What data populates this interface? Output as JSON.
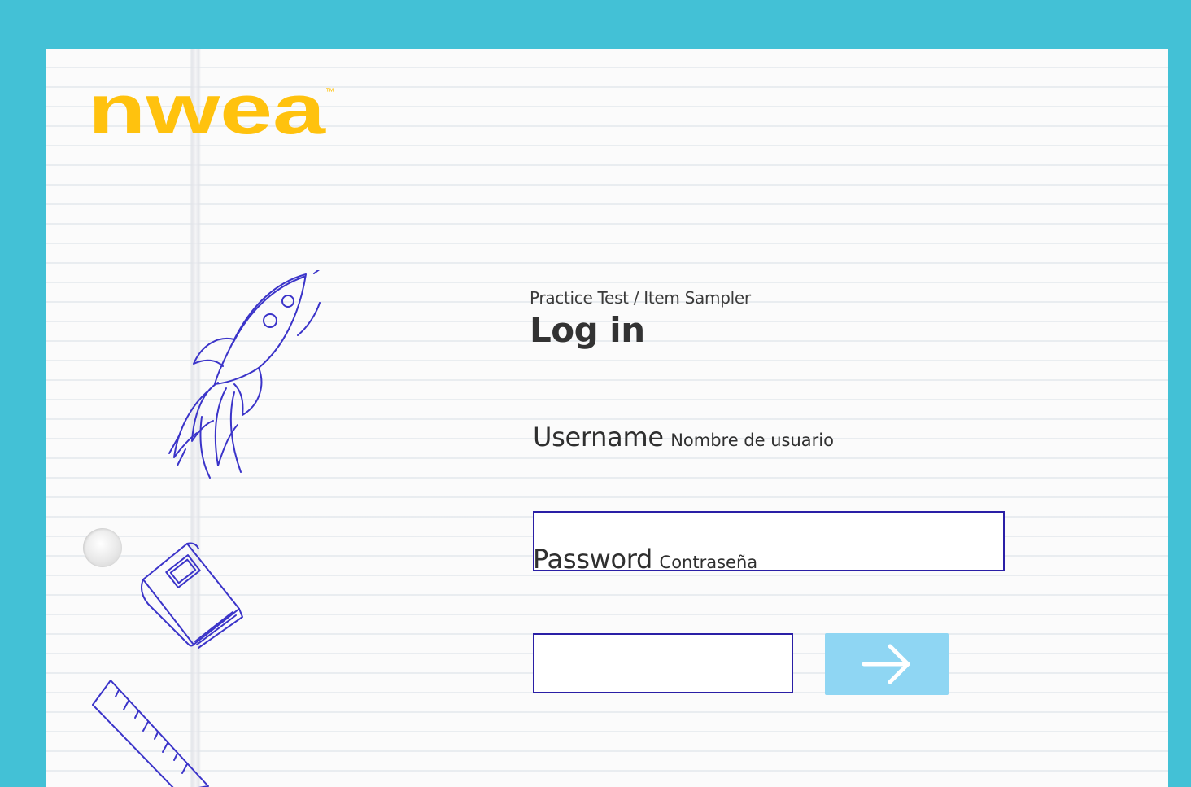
{
  "brand": {
    "logo_text": "nwea",
    "trademark": "™",
    "logo_color": "#ffc20e"
  },
  "login": {
    "subtitle": "Practice Test / Item Sampler",
    "title": "Log in",
    "username_label": "Username",
    "username_label_es": "Nombre de usuario",
    "username_value": "",
    "password_label": "Password",
    "password_label_es": "Contraseña",
    "password_value": "",
    "submit_icon": "arrow-right-icon"
  },
  "colors": {
    "background": "#43c1d6",
    "input_border": "#2a1fa6",
    "submit_button": "#8fd6f3",
    "doodle_ink": "#3b34c9"
  },
  "decorations": [
    "rocket-doodle",
    "book-doodle",
    "ruler-doodle",
    "punch-hole"
  ]
}
